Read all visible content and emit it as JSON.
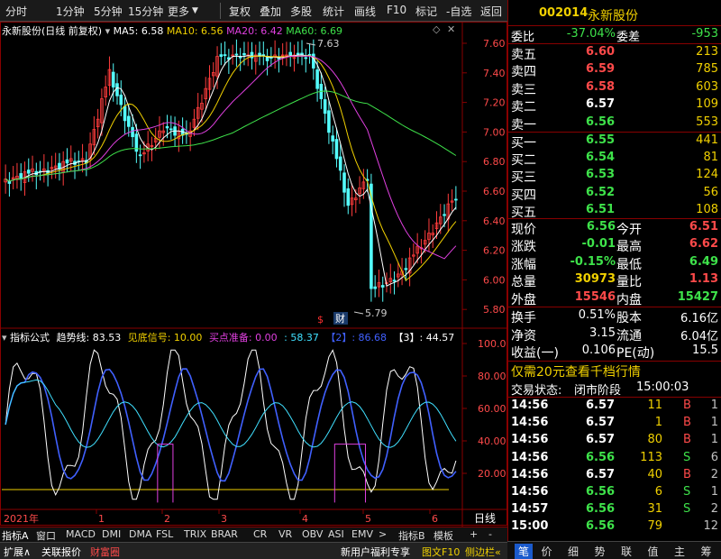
{
  "toolbar": {
    "left": [
      "分时",
      "1分钟",
      "5分钟",
      "15分钟",
      "更多"
    ],
    "right": [
      "复权",
      "叠加",
      "多股",
      "统计",
      "画线",
      "F10",
      "标记",
      "-自选",
      "返回"
    ]
  },
  "kline": {
    "stock_title": "永新股份(日线 前复权)",
    "ma5": "MA5: 6.58",
    "ma10": "MA10: 6.56",
    "ma20": "MA20: 6.42",
    "ma60": "MA60: 6.69",
    "high_label": "7.63",
    "low_label": "5.79",
    "marker_dollar": "$",
    "marker_cai": "财",
    "y_ticks": [
      "7.60",
      "7.40",
      "7.20",
      "7.00",
      "6.80",
      "6.60",
      "6.40",
      "6.20",
      "6.00",
      "5.80"
    ]
  },
  "indicator": {
    "formula_label": "指标公式",
    "trend_label": "趋势线: 83.53",
    "bottom_signal": "见底信号: 10.00",
    "buy_ready": "买点准备: 0.00",
    "val1": ": 58.37",
    "val2": "【2】: 86.68",
    "val3": "【3】: 44.57",
    "y_ticks": [
      "100.0",
      "80.00",
      "60.00",
      "40.00",
      "20.00"
    ]
  },
  "x_axis": {
    "year": "2021年",
    "months": [
      "1",
      "2",
      "3",
      "4",
      "5",
      "6"
    ],
    "period": "日线"
  },
  "tabs": [
    "指标A",
    "窗口",
    "MACD",
    "DMI",
    "DMA",
    "FSL",
    "TRIX",
    "BRAR",
    "CR",
    "VR",
    "OBV",
    "ASI",
    "EMV",
    ">",
    "指标B",
    "模板",
    "+",
    "-"
  ],
  "bottombar": {
    "expand": "扩展∧",
    "guanlian": "关联报价",
    "caifu": "财富圈",
    "promo": "新用户福利专享",
    "tuwen": "图文F10",
    "side": "侧边栏«"
  },
  "quote": {
    "code": "002014",
    "name": "永新股份",
    "weibi_label": "委比",
    "weibi": "-37.04%",
    "weicha_label": "委差",
    "weicha": "-953",
    "sell": [
      {
        "label": "卖五",
        "price": "6.60",
        "vol": "213"
      },
      {
        "label": "卖四",
        "price": "6.59",
        "vol": "785"
      },
      {
        "label": "卖三",
        "price": "6.58",
        "vol": "603"
      },
      {
        "label": "卖二",
        "price": "6.57",
        "vol": "109"
      },
      {
        "label": "卖一",
        "price": "6.56",
        "vol": "553"
      }
    ],
    "buy": [
      {
        "label": "买一",
        "price": "6.55",
        "vol": "441"
      },
      {
        "label": "买二",
        "price": "6.54",
        "vol": "81"
      },
      {
        "label": "买三",
        "price": "6.53",
        "vol": "124"
      },
      {
        "label": "买四",
        "price": "6.52",
        "vol": "56"
      },
      {
        "label": "买五",
        "price": "6.51",
        "vol": "108"
      }
    ],
    "stats": [
      {
        "l1": "现价",
        "v1": "6.56",
        "l2": "今开",
        "v2": "6.51"
      },
      {
        "l1": "涨跌",
        "v1": "-0.01",
        "l2": "最高",
        "v2": "6.62"
      },
      {
        "l1": "涨幅",
        "v1": "-0.15%",
        "l2": "最低",
        "v2": "6.49"
      },
      {
        "l1": "总量",
        "v1": "30973",
        "l2": "量比",
        "v2": "1.13"
      },
      {
        "l1": "外盘",
        "v1": "15546",
        "l2": "内盘",
        "v2": "15427"
      }
    ],
    "stats2": [
      {
        "l1": "换手",
        "v1": "0.51%",
        "l2": "股本",
        "v2": "6.16亿"
      },
      {
        "l1": "净资",
        "v1": "3.15",
        "l2": "流通",
        "v2": "6.04亿"
      },
      {
        "l1": "收益(一)",
        "v1": "0.106",
        "l2": "PE(动)",
        "v2": "15.5"
      }
    ],
    "promo": "仅需20元查看千档行情",
    "trade_status_label": "交易状态:",
    "trade_status": "闭市阶段",
    "trade_time": "15:00:03",
    "ticks": [
      {
        "t": "14:56",
        "p": "6.57",
        "v": "11",
        "bs": "B",
        "n": "1"
      },
      {
        "t": "14:56",
        "p": "6.57",
        "v": "1",
        "bs": "B",
        "n": "1"
      },
      {
        "t": "14:56",
        "p": "6.57",
        "v": "80",
        "bs": "B",
        "n": "1"
      },
      {
        "t": "14:56",
        "p": "6.56",
        "v": "113",
        "bs": "S",
        "n": "6"
      },
      {
        "t": "14:56",
        "p": "6.57",
        "v": "40",
        "bs": "B",
        "n": "2"
      },
      {
        "t": "14:56",
        "p": "6.56",
        "v": "6",
        "bs": "S",
        "n": "1"
      },
      {
        "t": "14:57",
        "p": "6.56",
        "v": "31",
        "bs": "S",
        "n": "2"
      },
      {
        "t": "15:00",
        "p": "6.56",
        "v": "79",
        "bs": "",
        "n": "12"
      }
    ],
    "nav": [
      "笔",
      "价",
      "细",
      "势",
      "联",
      "值",
      "主",
      "筹"
    ]
  }
}
